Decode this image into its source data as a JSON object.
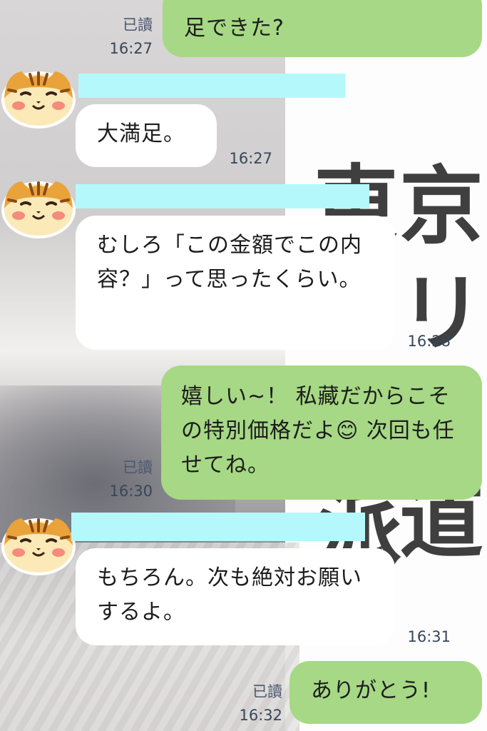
{
  "background_text": {
    "k1": "京",
    "k2": "東",
    "k3": "リ",
    "k4": "道",
    "k5": "派"
  },
  "messages": [
    {
      "id": "m1",
      "side": "out",
      "text": "足できた?",
      "read": "已讀",
      "time": "16:27"
    },
    {
      "id": "m2",
      "side": "in",
      "text": "大満足。",
      "time": "16:27"
    },
    {
      "id": "m3",
      "side": "in",
      "text": "むしろ「この金額でこの内容？」って思ったくらい。",
      "time": "16:28"
    },
    {
      "id": "m4",
      "side": "out",
      "text": "嬉しい~！ 私藏だからこその特別価格だよ😊 次回も任せてね。",
      "read": "已讀",
      "time": "16:30"
    },
    {
      "id": "m5",
      "side": "in",
      "text": "もちろん。次も絶対お願いするよ。",
      "time": "16:31"
    },
    {
      "id": "m6",
      "side": "out",
      "text": "ありがとう!",
      "read": "已讀",
      "time": "16:32"
    }
  ],
  "avatar": {
    "icon": "tiger-cat-icon",
    "colors": {
      "fur": "#e9a33a",
      "stripe": "#8a4b16",
      "face": "#fbe9b8",
      "cheek": "#f58b7a"
    }
  },
  "colors": {
    "outgoing": "#a6d885",
    "incoming": "#ffffff",
    "name_redaction": "#b5f8fb"
  }
}
